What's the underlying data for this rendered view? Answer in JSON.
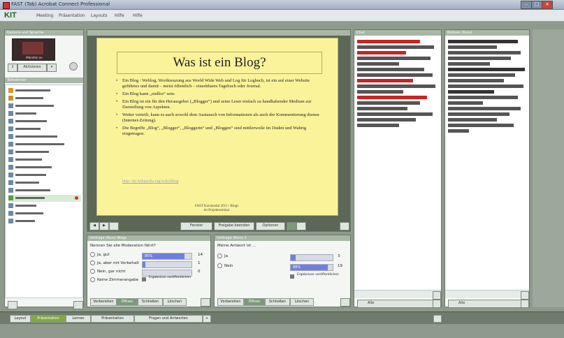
{
  "window": {
    "title": "FAST (Tab) Acrobat Connect Professional",
    "buttons": [
      "–",
      "□",
      "×"
    ]
  },
  "menubar": {
    "logo": "KIT",
    "items": [
      "Meeting",
      "Präsentation",
      "Layouts",
      "Hilfe",
      "Hilfe"
    ]
  },
  "left_panel": {
    "header": "Kamera und Sprache",
    "video_caption": "Mikrofon an",
    "toolbar": [
      "↕",
      "Aktivieren",
      "▾"
    ],
    "attendee_header": "Teilnehmer",
    "attendees_visible": 18
  },
  "slide": {
    "title": "Was ist ein Blog?",
    "bullets": [
      "Ein Blog / Weblog, Wortkreuzung aus World Wide Web und Log für Logbuch, ist ein auf einer Website geführtes und damit – meist öffentlich – einsehbares Tagebuch oder Journal.",
      "Ein Blog kann „endlos“ sein.",
      "Ein Blog ist ein für den Herausgeber („Blogger“) und seine Leser einfach zu handhabender Medium zur Darstellung von Aspekten.",
      "Weiter verteilt, kann es auch sowohl dem Austausch von Informationen als auch der Kommentierung dienen (Internet-Zeitung).",
      "Die Begriffe „Blog“, „Blogger“, „Bloggerin“ und „Bloggen“ sind mittlerweile im Duden und Wahrig eingetragen."
    ],
    "link": "http://de.wikipedia.org/wiki/Blog",
    "footer_line1": "FAST Kursmodul 2011 / Blogs",
    "footer_line2": "im Projektseminar"
  },
  "slide_toolbar": {
    "page": "Fenster",
    "sync": "Freigabe beenden",
    "zoom": "Optionen"
  },
  "poll1": {
    "header": "Umfrage (Kurs) Blogs",
    "question": "Nennen Sie alle Moderation fährt?",
    "options": [
      {
        "label": "Ja, gut",
        "count": "14",
        "fill": 0.85,
        "bar_text": "85%"
      },
      {
        "label": "Ja, aber mit Vorbehalt",
        "count": "1",
        "fill": 0.06,
        "bar_text": ""
      },
      {
        "label": "Nein, gar nicht",
        "count": "0",
        "fill": 0.0,
        "bar_text": ""
      },
      {
        "label": "Keine Zimmerangabe",
        "count": "",
        "fill": 0.0,
        "bar_text": ""
      }
    ],
    "note": "Ergebnisse veröffentlichen",
    "tabs": [
      "Vorbereiten",
      "Öffnen",
      "Schließen",
      "Löschen"
    ]
  },
  "poll2": {
    "header": "Umfrage (Kurs) 2",
    "question": "Meine Antwort ist ...",
    "options": [
      {
        "label": "Ja",
        "count": "3",
        "fill": 0.12,
        "bar_text": ""
      },
      {
        "label": "Nein",
        "count": "19",
        "fill": 0.88,
        "bar_text": "88%"
      }
    ],
    "note": "Ergebnisse veröffentlichen",
    "tabs": [
      "Vorbereiten",
      "Öffnen",
      "Schließen",
      "Löschen"
    ]
  },
  "chat1": {
    "header": "Chat",
    "send_to": "Alle"
  },
  "chat2": {
    "header": "Notizen (Kurs)",
    "send_to": "Alle"
  },
  "bottom_tabs": [
    "Layout",
    "Präsentation",
    "Lernen",
    "Präsentation",
    "Fragen und Antworten"
  ],
  "colors": {
    "slide_bg": "#fbf39a",
    "panel_head": "#a7b6a5",
    "poll_bar": "#6f7fe0"
  }
}
